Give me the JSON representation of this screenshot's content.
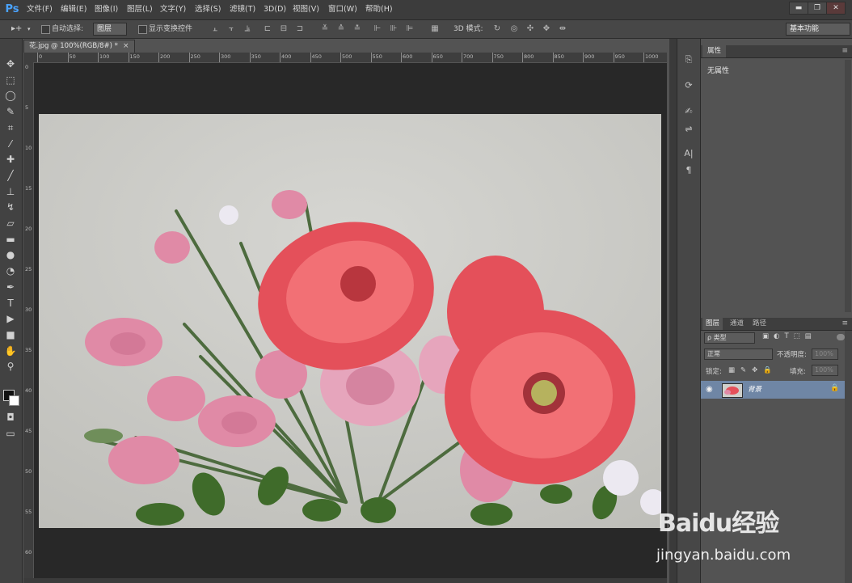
{
  "app": {
    "logo": "Ps"
  },
  "menu": [
    "文件(F)",
    "编辑(E)",
    "图像(I)",
    "图层(L)",
    "文字(Y)",
    "选择(S)",
    "滤镜(T)",
    "3D(D)",
    "视图(V)",
    "窗口(W)",
    "帮助(H)"
  ],
  "window_controls": {
    "minimize": "▬",
    "restore": "❐",
    "close": "✕"
  },
  "options": {
    "tool_glyph": "▸+",
    "auto_select_label": "自动选择:",
    "auto_select_value": "图层",
    "show_transform_label": "显示变换控件",
    "mode_3d_label": "3D 模式:",
    "workspace": "基本功能"
  },
  "document": {
    "tab_title": "花.jpg @ 100%(RGB/8#) *",
    "close_glyph": "×",
    "ruler_marks": [
      "0",
      "50",
      "100",
      "150",
      "200",
      "250",
      "300",
      "350",
      "400",
      "450",
      "500",
      "550",
      "600",
      "650",
      "700",
      "750",
      "800",
      "850",
      "900",
      "950",
      "1000"
    ],
    "ruler_v_marks": [
      "0",
      "5",
      "10",
      "15",
      "20",
      "25",
      "30",
      "35",
      "40",
      "45",
      "50",
      "55",
      "60"
    ]
  },
  "properties_panel": {
    "tab": "属性",
    "body": "无属性"
  },
  "layers_panel": {
    "tabs": [
      "图层",
      "通道",
      "路径"
    ],
    "filter_label": "ρ 类型",
    "blend_mode": "正常",
    "opacity_label": "不透明度:",
    "opacity_value": "100%",
    "lock_label": "锁定:",
    "fill_label": "填充:",
    "fill_value": "100%",
    "layer_name": "背景",
    "eye_glyph": "👁",
    "lock_glyph": "🔒"
  },
  "watermark": {
    "logo": "Baidu经验",
    "url": "jingyan.baidu.com"
  },
  "tools": [
    {
      "name": "move-tool",
      "glyph": "✥"
    },
    {
      "name": "marquee-tool",
      "glyph": "⬚"
    },
    {
      "name": "lasso-tool",
      "glyph": "◯"
    },
    {
      "name": "quick-select-tool",
      "glyph": "✎"
    },
    {
      "name": "crop-tool",
      "glyph": "⌗"
    },
    {
      "name": "eyedropper-tool",
      "glyph": "⁄"
    },
    {
      "name": "healing-tool",
      "glyph": "✚"
    },
    {
      "name": "brush-tool",
      "glyph": "╱"
    },
    {
      "name": "stamp-tool",
      "glyph": "⊥"
    },
    {
      "name": "history-brush-tool",
      "glyph": "↯"
    },
    {
      "name": "eraser-tool",
      "glyph": "▱"
    },
    {
      "name": "gradient-tool",
      "glyph": "▬"
    },
    {
      "name": "blur-tool",
      "glyph": "●"
    },
    {
      "name": "dodge-tool",
      "glyph": "◔"
    },
    {
      "name": "pen-tool",
      "glyph": "✒"
    },
    {
      "name": "type-tool",
      "glyph": "T"
    },
    {
      "name": "path-select-tool",
      "glyph": "▶"
    },
    {
      "name": "shape-tool",
      "glyph": "■"
    },
    {
      "name": "hand-tool",
      "glyph": "✋"
    },
    {
      "name": "zoom-tool",
      "glyph": "⚲"
    }
  ],
  "dock_icons": [
    {
      "name": "history-icon",
      "glyph": "⎘"
    },
    {
      "name": "actions-icon",
      "glyph": "⟳"
    },
    {
      "name": "brush-preset-icon",
      "glyph": "✍"
    },
    {
      "name": "adjust-icon",
      "glyph": "⇌"
    },
    {
      "name": "character-icon",
      "glyph": "A|"
    },
    {
      "name": "paragraph-icon",
      "glyph": "¶"
    }
  ],
  "colors": {
    "accent": "#4aa3ff",
    "selected_layer": "#6f86a5"
  }
}
